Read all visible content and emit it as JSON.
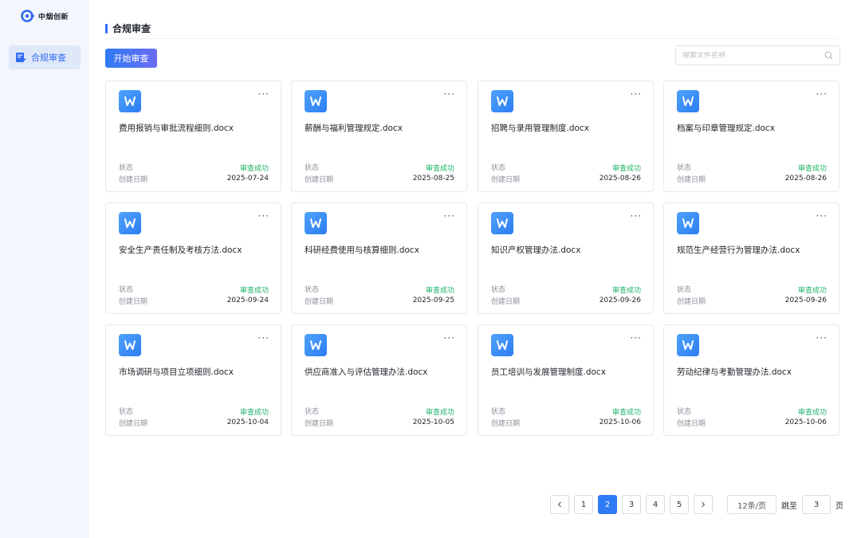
{
  "brand": {
    "name": "中烟创新",
    "accent": "#2f6bf2"
  },
  "sidebar": {
    "items": [
      {
        "label": "合规审查",
        "icon": "document-check-icon",
        "active": true
      }
    ]
  },
  "header": {
    "title": "合规审查"
  },
  "toolbar": {
    "start_label": "开始审查"
  },
  "search": {
    "placeholder": "搜索文件名称",
    "value": ""
  },
  "labels": {
    "status": "状态",
    "created": "创建日期"
  },
  "files": [
    {
      "name": "费用报销与审批流程细则.docx",
      "status": "审查成功",
      "date": "2025-07-24"
    },
    {
      "name": "薪酬与福利管理规定.docx",
      "status": "审查成功",
      "date": "2025-08-25"
    },
    {
      "name": "招聘与录用管理制度.docx",
      "status": "审查成功",
      "date": "2025-08-26"
    },
    {
      "name": "档案与印章管理规定.docx",
      "status": "审查成功",
      "date": "2025-08-26"
    },
    {
      "name": "安全生产责任制及考核方法.docx",
      "status": "审查成功",
      "date": "2025-09-24"
    },
    {
      "name": "科研经费使用与核算细则.docx",
      "status": "审查成功",
      "date": "2025-09-25"
    },
    {
      "name": "知识产权管理办法.docx",
      "status": "审查成功",
      "date": "2025-09-26"
    },
    {
      "name": "规范生产经营行为管理办法.docx",
      "status": "审查成功",
      "date": "2025-09-26"
    },
    {
      "name": "市场调研与项目立项细则.docx",
      "status": "审查成功",
      "date": "2025-10-04"
    },
    {
      "name": "供应商准入与评估管理办法.docx",
      "status": "审查成功",
      "date": "2025-10-05"
    },
    {
      "name": "员工培训与发展管理制度.docx",
      "status": "审查成功",
      "date": "2025-10-06"
    },
    {
      "name": "劳动纪律与考勤管理办法.docx",
      "status": "审查成功",
      "date": "2025-10-06"
    }
  ],
  "pagination": {
    "pages": [
      "1",
      "2",
      "3",
      "4",
      "5"
    ],
    "current": "2",
    "page_size": "12条/页",
    "jump_label": "跳至",
    "jump_value": "3",
    "unit": "页"
  },
  "colors": {
    "success": "#20b26b",
    "primary": "#2f7bf5"
  }
}
